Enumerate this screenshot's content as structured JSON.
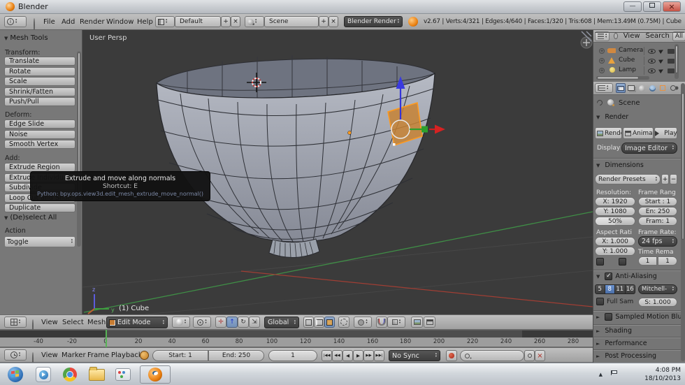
{
  "titlebar": {
    "title": "Blender"
  },
  "header": {
    "menus": [
      "File",
      "Add",
      "Render",
      "Window",
      "Help"
    ],
    "layout": "Default",
    "scene": "Scene",
    "engine": "Blender Render",
    "stats": "v2.67 | Verts:4/321 | Edges:4/640 | Faces:1/320 | Tris:608 | Mem:13.49M (0.75M) | Cube"
  },
  "tool_shelf": {
    "title": "Mesh Tools",
    "transform_label": "Transform:",
    "transform_buttons": [
      "Translate",
      "Rotate",
      "Scale",
      "Shrink/Fatten",
      "Push/Pull"
    ],
    "deform_label": "Deform:",
    "deform_buttons": [
      "Edge Slide",
      "Noise",
      "Smooth Vertex"
    ],
    "add_label": "Add:",
    "add_buttons": [
      "Extrude Region",
      "Extrude Individual",
      "Subdivide",
      "Loop Cut and Slide",
      "Duplicate"
    ],
    "deselect_title": "(De)select All",
    "action_label": "Action",
    "action_value": "Toggle"
  },
  "tooltip": {
    "title": "Extrude and move along normals",
    "shortcut": "Shortcut: E",
    "python": "Python: bpy.ops.view3d.edit_mesh_extrude_move_normal()"
  },
  "viewport": {
    "view": "User Persp",
    "object": "(1) Cube",
    "axis_z": "z",
    "axis_y": "y"
  },
  "outliner": {
    "menus": [
      "View",
      "Search"
    ],
    "scene_filter": "All Scenes",
    "items": [
      "Camera",
      "Cube",
      "Lamp"
    ]
  },
  "properties": {
    "context": "Scene",
    "render": {
      "title": "Render",
      "buttons": [
        "Render",
        "Animation",
        "Play"
      ],
      "display_label": "Display",
      "display_value": "Image Editor"
    },
    "dimensions": {
      "title": "Dimensions",
      "presets": "Render Presets",
      "resolution_label": "Resolution:",
      "x": "X: 1920",
      "y": "Y: 1080",
      "percent": "50%",
      "frame_range_label": "Frame Rang",
      "start": "Start : 1",
      "end": "En: 250",
      "step": "Fram: 1",
      "aspect_label": "Aspect Rati",
      "aspect_x": "X: 1.000",
      "aspect_y": "Y: 1.000",
      "frame_rate_label": "Frame Rate:",
      "fps": "24 fps",
      "time_remap_label": "Time Rema",
      "remap_old": "1",
      "remap_new": "1"
    },
    "anti_aliasing": {
      "title": "Anti-Aliasing",
      "samples": [
        "5",
        "8",
        "11",
        "16"
      ],
      "active": "8",
      "filter": "Mitchell-",
      "full_sample": "Full Sam",
      "size": "S: 1.000"
    },
    "collapsed": [
      "Sampled Motion Blur",
      "Shading",
      "Performance",
      "Post Processing"
    ]
  },
  "view3d_header": {
    "menus": [
      "View",
      "Select",
      "Mesh"
    ],
    "mode": "Edit Mode",
    "orientation": "Global"
  },
  "timeline": {
    "ticks": [
      "-40",
      "-20",
      "0",
      "20",
      "40",
      "60",
      "80",
      "100",
      "120",
      "140",
      "160",
      "180",
      "200",
      "220",
      "240",
      "260",
      "280"
    ],
    "menus": [
      "View",
      "Marker",
      "Frame",
      "Playback"
    ],
    "start": "Start: 1",
    "end": "End: 250",
    "frame": "1",
    "sync": "No Sync",
    "playback": [
      "|◀◀",
      "◀◀",
      "◀",
      "▶",
      "▶▶",
      "▶▶|"
    ]
  },
  "taskbar": {
    "time": "4:08 PM",
    "date": "18/10/2013"
  },
  "icons": {
    "close": "×",
    "minimize": "—",
    "plus": "+",
    "minus": "−",
    "panel_open": "▼",
    "panel_closed": "►",
    "check": "✓",
    "tray_up": "▲",
    "cursor": "▶"
  },
  "colors": {
    "selection_orange": "#ff9a1e",
    "active_blue": "#5680c2",
    "record_red": "#b53227"
  }
}
